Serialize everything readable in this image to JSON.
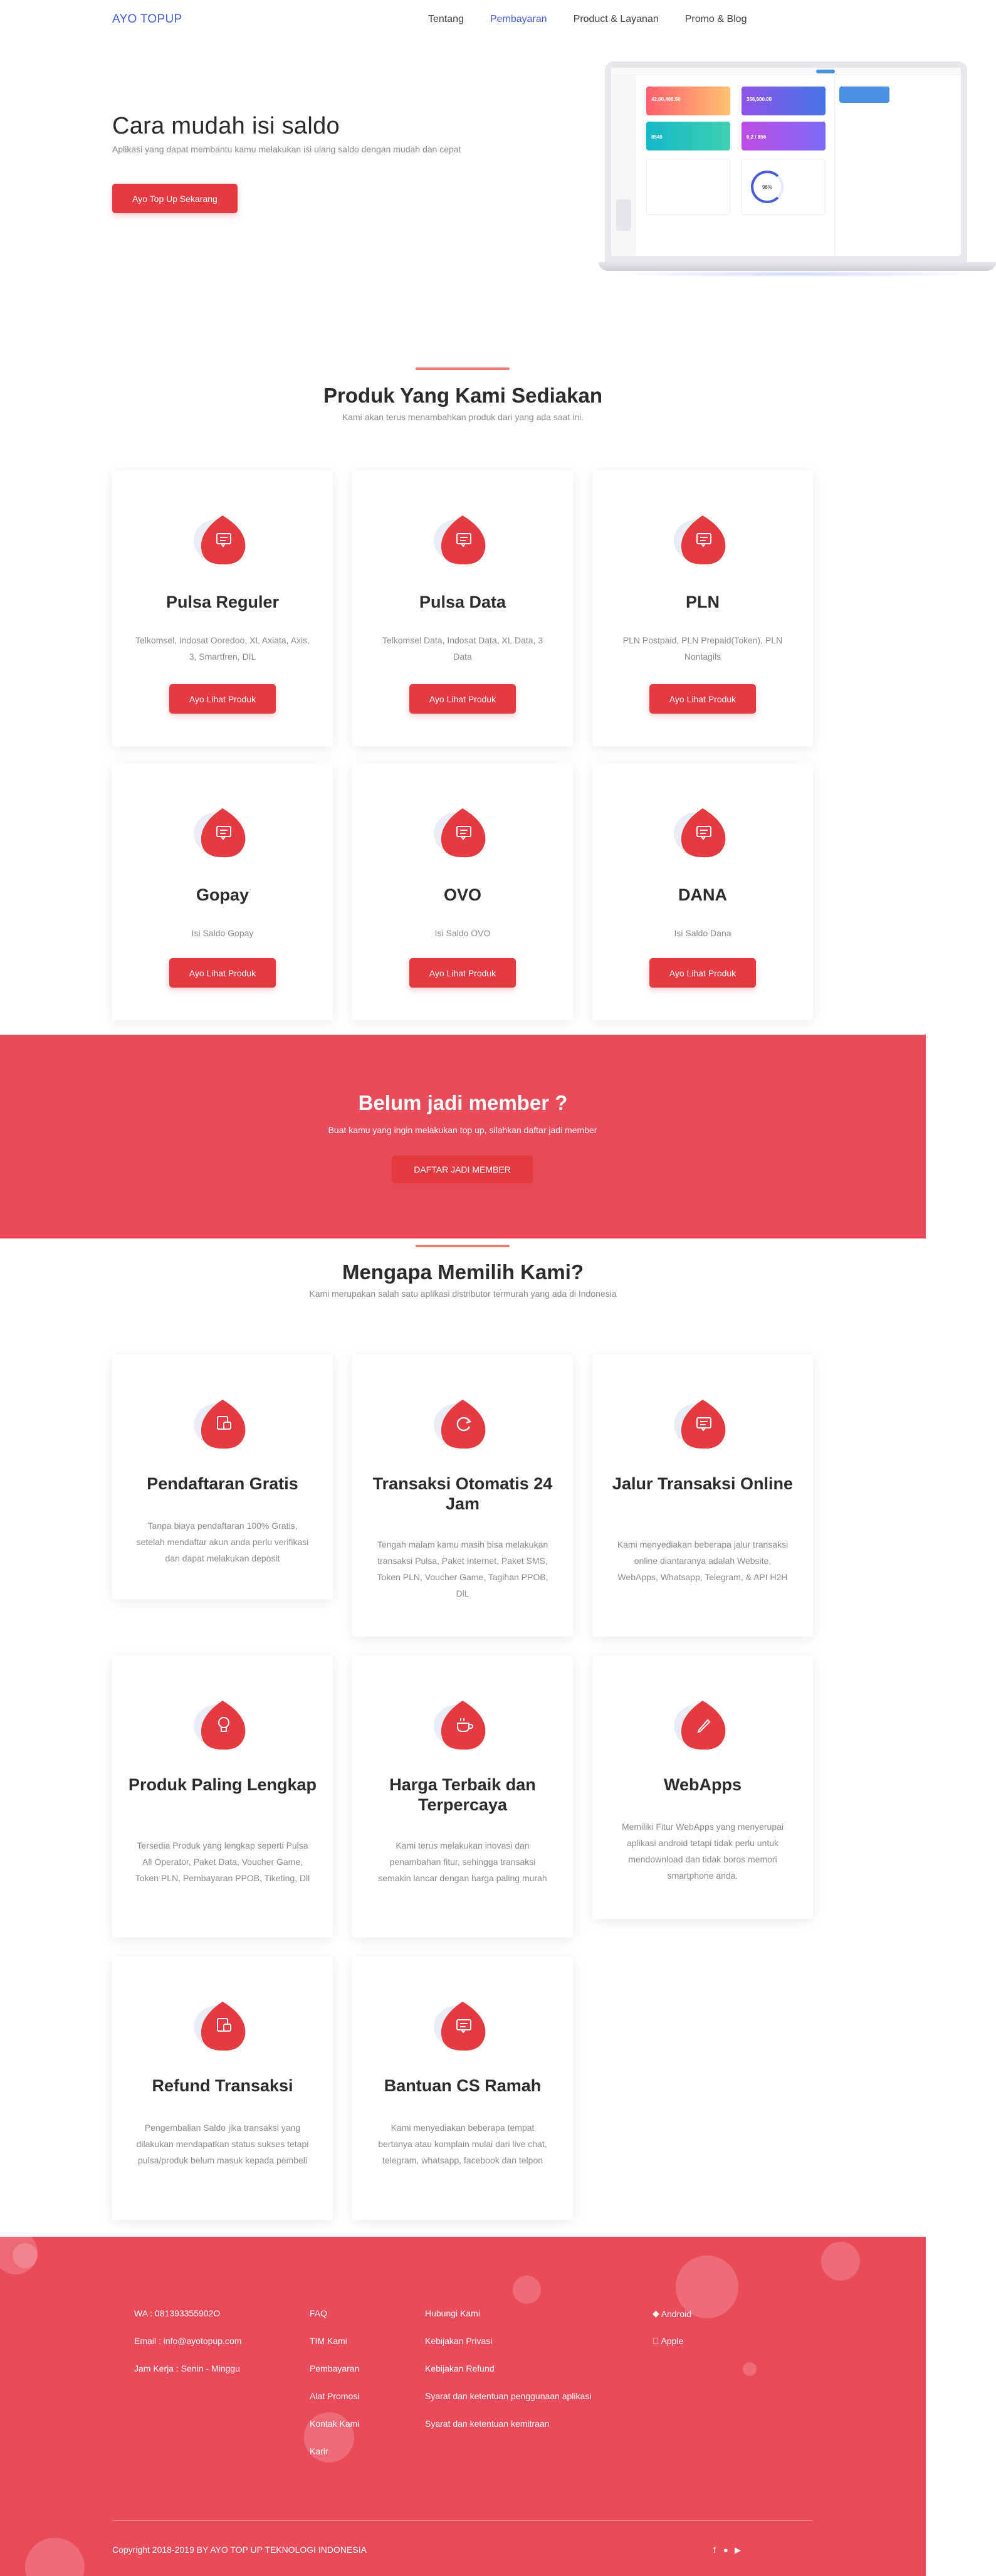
{
  "nav": {
    "brand": "AYO TOPUP",
    "links": [
      "Tentang",
      "Pembayaran",
      "Product & Layanan",
      "Promo & Blog"
    ]
  },
  "hero": {
    "title": "Cara mudah isi saldo",
    "subtitle": "Aplikasi yang dapat membantu kamu melakukan isi ulang saldo dengan mudah dan cepat",
    "button": "Ayo Top Up Sekarang"
  },
  "products": {
    "title": "Produk Yang Kami Sediakan",
    "subtitle": "Kami akan terus menambahkan produk dari yang ada saat ini.",
    "button": "Ayo Lihat Produk",
    "items": [
      {
        "title": "Pulsa Reguler",
        "desc": "Telkomsel, Indosat Ooredoo, XL Axiata, Axis, 3, Smartfren, DIL"
      },
      {
        "title": "Pulsa Data",
        "desc": "Telkomsel Data, Indosat Data, XL Data, 3 Data"
      },
      {
        "title": "PLN",
        "desc": "PLN Postpaid, PLN Prepaid(Token), PLN Nontagils"
      },
      {
        "title": "Gopay",
        "desc": "Isi Saldo Gopay"
      },
      {
        "title": "OVO",
        "desc": "Isi Saldo OVO"
      },
      {
        "title": "DANA",
        "desc": "Isi Saldo Dana"
      }
    ]
  },
  "banner": {
    "title": "Belum jadi member ?",
    "text": "Buat kamu yang ingin melakukan top up, silahkan daftar jadi member",
    "button": "DAFTAR JADI MEMBER"
  },
  "why": {
    "title": "Mengapa Memilih Kami?",
    "subtitle": "Kami merupakan salah satu aplikasi distributor termurah yang ada di Indonesia",
    "items": [
      {
        "title": "Pendaftaran Gratis",
        "desc": "Tanpa biaya pendaftaran 100% Gratis, setelah mendaftar akun anda perlu verifikasi dan dapat melakukan deposit",
        "icon": "register-icon"
      },
      {
        "title": "Transaksi Otomatis 24 Jam",
        "desc": "Tengah malam kamu masih bisa melakukan transaksi Pulsa, Paket Internet, Paket SMS, Token PLN, Voucher Game, Tagihan PPOB, DlL",
        "icon": "refresh-icon"
      },
      {
        "title": "Jalur Transaksi Online",
        "desc": "Kami menyediakan beberapa jalur transaksi online diantaranya adalah Website, WebApps, Whatsapp, Telegram, & API H2H",
        "icon": "message-icon"
      },
      {
        "title": "Produk Paling Lengkap",
        "desc": "Tersedia Produk yang lengkap seperti Pulsa All Operator, Paket Data, Voucher Game, Token PLN, Pembayaran PPOB, Tiketing, Dll",
        "icon": "bulb-icon"
      },
      {
        "title": "Harga Terbaik dan Terpercaya",
        "desc": "Kami terus melakukan inovasi dan penambahan fitur, sehingga transaksi semakin lancar dengan harga paling murah",
        "icon": "coffee-icon"
      },
      {
        "title": "WebApps",
        "desc": "Memiliki Fitur WebApps yang menyerupai aplikasi android tetapi tidak perlu untuk mendownload dan tidak boros memori smartphone anda.",
        "icon": "pencil-icon"
      },
      {
        "title": "Refund Transaksi",
        "desc": "Pengembalian Saldo jika transaksi yang dilakukan mendapatkan status sukses tetapi pulsa/produk belum masuk kepada pembeli",
        "icon": "register-icon"
      },
      {
        "title": "Bantuan CS Ramah",
        "desc": "Kami menyediakan beberapa tempat bertanya atau komplain mulai dari live chat, telegram, whatsapp, facebook dan telpon",
        "icon": "message-icon"
      }
    ]
  },
  "footer": {
    "contact": [
      "WA : 081393355902O",
      "Email : info@ayotopup.com",
      "Jam Kerja : Senin - Minggu"
    ],
    "col2": [
      "FAQ",
      "TIM Kami",
      "Pembayaran",
      "Alat Promosi",
      "Kontak Kami",
      "Karir"
    ],
    "col3": [
      "Hubungi Kami",
      "Kebijakan Privasi",
      "Kebijakan Refund",
      "Syarat dan ketentuan penggunaan aplikasi",
      "Syarat dan ketentuan kemitraan"
    ],
    "apps": [
      "Android",
      "Apple"
    ],
    "copyright": "Copyright 2018-2019 BY AYO TOP UP TEKNOLOGI INDONESIA"
  },
  "mockup": {
    "card1_value": "42,00,469.50",
    "card2_value": "356,600.00",
    "card3_value": "8546",
    "card4_value": "6.2 / 856",
    "gauge_value": "98%"
  },
  "colors": {
    "accent": "#e53a3f",
    "banner": "#e94b5b",
    "link": "#4a5bd8"
  }
}
